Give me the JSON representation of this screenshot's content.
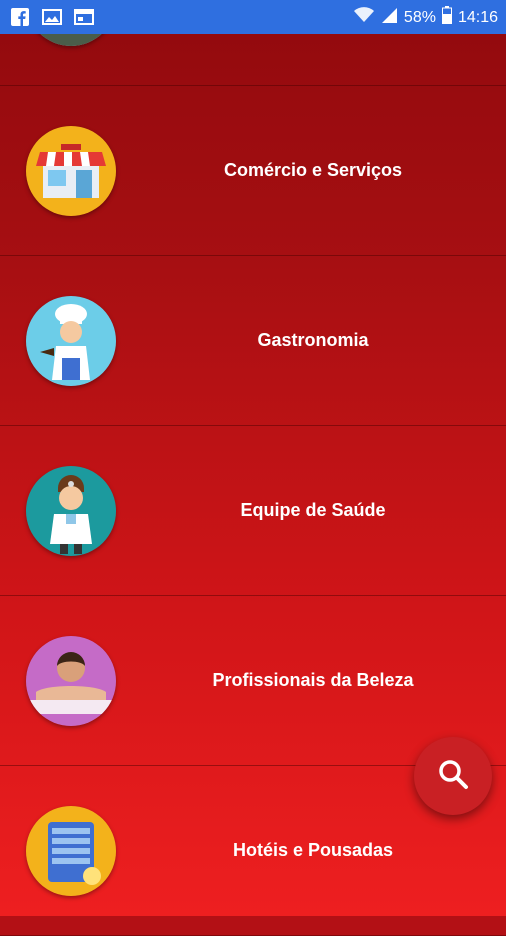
{
  "status_bar": {
    "battery": "58%",
    "time": "14:16",
    "icons": [
      "facebook-icon",
      "gallery-icon",
      "browser-icon",
      "wifi-icon",
      "signal-icon",
      "battery-icon"
    ]
  },
  "categories": [
    {
      "label": "",
      "icon": "city-avatar-icon"
    },
    {
      "label": "Comércio e Serviços",
      "icon": "shop-avatar-icon"
    },
    {
      "label": "Gastronomia",
      "icon": "chef-avatar-icon"
    },
    {
      "label": "Equipe de Saúde",
      "icon": "doctor-avatar-icon"
    },
    {
      "label": "Profissionais da Beleza",
      "icon": "spa-avatar-icon"
    },
    {
      "label": "Hotéis e Pousadas",
      "icon": "hotel-avatar-icon"
    }
  ],
  "fab": {
    "icon": "search-icon"
  },
  "colors": {
    "status_bar": "#2f6fe0",
    "list_top": "#8a080c",
    "list_bottom": "#ee1f20",
    "fab": "#c92024"
  }
}
